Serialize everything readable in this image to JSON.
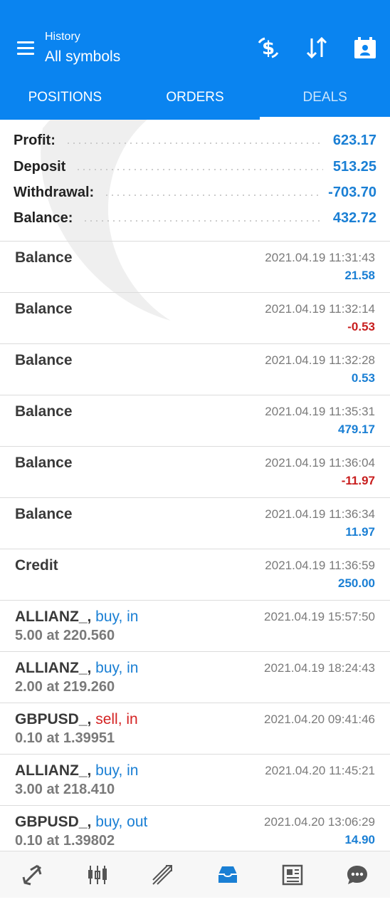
{
  "header": {
    "subtitle": "History",
    "title": "All symbols",
    "icons": [
      "menu-icon",
      "currency-filter-icon",
      "sort-icon",
      "calendar-icon"
    ]
  },
  "tabs": [
    {
      "label": "POSITIONS",
      "active": false
    },
    {
      "label": "ORDERS",
      "active": false
    },
    {
      "label": "DEALS",
      "active": true
    }
  ],
  "summary": [
    {
      "label": "Profit:",
      "value": "623.17"
    },
    {
      "label": "Deposit",
      "value": "513.25"
    },
    {
      "label": "Withdrawal:",
      "value": "-703.70"
    },
    {
      "label": "Balance:",
      "value": "432.72"
    }
  ],
  "deals": [
    {
      "name": "Balance",
      "side": "",
      "sub": "",
      "time": "2021.04.19 11:31:43",
      "amount": "21.58"
    },
    {
      "name": "Balance",
      "side": "",
      "sub": "",
      "time": "2021.04.19 11:32:14",
      "amount": "-0.53"
    },
    {
      "name": "Balance",
      "side": "",
      "sub": "",
      "time": "2021.04.19 11:32:28",
      "amount": "0.53"
    },
    {
      "name": "Balance",
      "side": "",
      "sub": "",
      "time": "2021.04.19 11:35:31",
      "amount": "479.17"
    },
    {
      "name": "Balance",
      "side": "",
      "sub": "",
      "time": "2021.04.19 11:36:04",
      "amount": "-11.97"
    },
    {
      "name": "Balance",
      "side": "",
      "sub": "",
      "time": "2021.04.19 11:36:34",
      "amount": "11.97"
    },
    {
      "name": "Credit",
      "side": "",
      "sub": "",
      "time": "2021.04.19 11:36:59",
      "amount": "250.00"
    },
    {
      "name": "ALLIANZ_,",
      "side": "buy, in",
      "sub": "5.00 at 220.560",
      "time": "2021.04.19 15:57:50",
      "amount": ""
    },
    {
      "name": "ALLIANZ_,",
      "side": "buy, in",
      "sub": "2.00 at 219.260",
      "time": "2021.04.19 18:24:43",
      "amount": ""
    },
    {
      "name": "GBPUSD_,",
      "side": "sell, in",
      "sub": "0.10 at 1.39951",
      "time": "2021.04.20 09:41:46",
      "amount": ""
    },
    {
      "name": "ALLIANZ_,",
      "side": "buy, in",
      "sub": "3.00 at 218.410",
      "time": "2021.04.20 11:45:21",
      "amount": ""
    },
    {
      "name": "GBPUSD_,",
      "side": "buy, out",
      "sub": "0.10 at 1.39802",
      "time": "2021.04.20 13:06:29",
      "amount": "14.90"
    }
  ],
  "bottom_nav": [
    {
      "icon": "quotes-icon",
      "active": false
    },
    {
      "icon": "chart-icon",
      "active": false
    },
    {
      "icon": "trade-icon",
      "active": false
    },
    {
      "icon": "history-icon",
      "active": true
    },
    {
      "icon": "news-icon",
      "active": false
    },
    {
      "icon": "chat-icon",
      "active": false
    }
  ],
  "colors": {
    "accent": "#0a84f0",
    "positive": "#1a7fd4",
    "negative": "#c81e1e"
  }
}
